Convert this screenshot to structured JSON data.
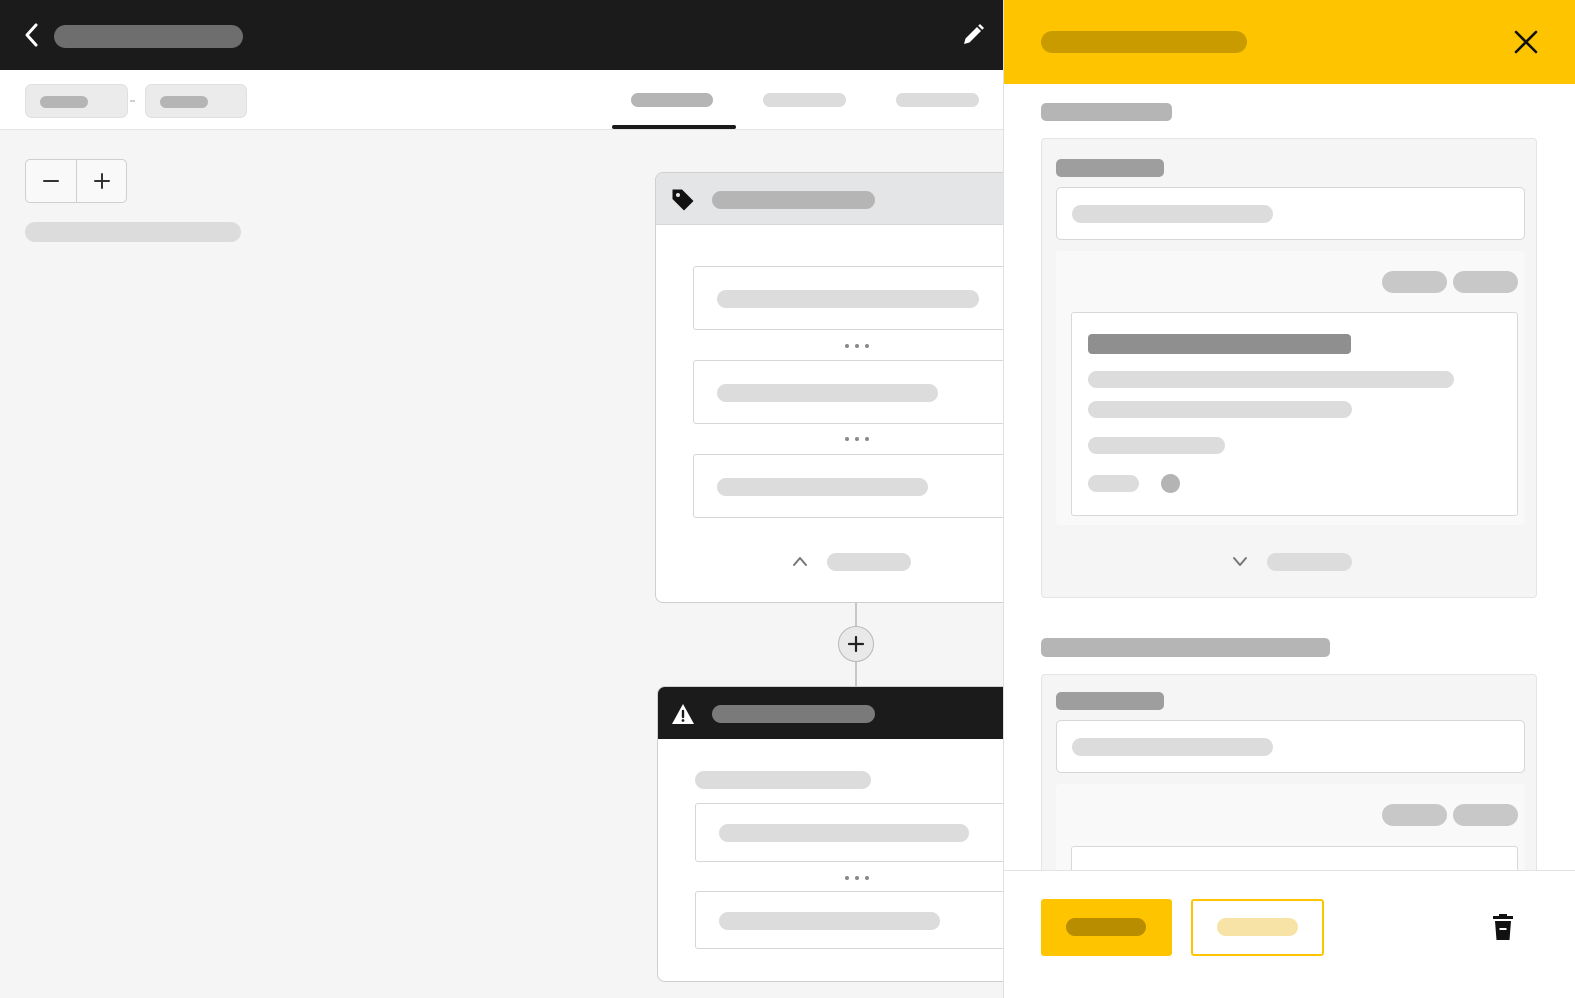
{
  "colors": {
    "accent": "#ffc400",
    "topbar": "#1b1b1b",
    "canvas": "#f5f5f5",
    "panel_header": "#ffc400",
    "warning_header": "#1b1b1b"
  },
  "icons": {
    "back": "chevron-left-icon",
    "edit": "pencil-icon",
    "close": "close-icon",
    "zoom_out": "minus-icon",
    "zoom_in": "plus-icon",
    "trigger_node": "tag-icon",
    "alert_node": "warning-icon",
    "add_step": "plus-icon",
    "collapse": "chevron-up-icon",
    "expand": "chevron-down-icon",
    "delete": "trash-icon"
  },
  "tabs": {
    "count": 3,
    "active_index": 0
  }
}
